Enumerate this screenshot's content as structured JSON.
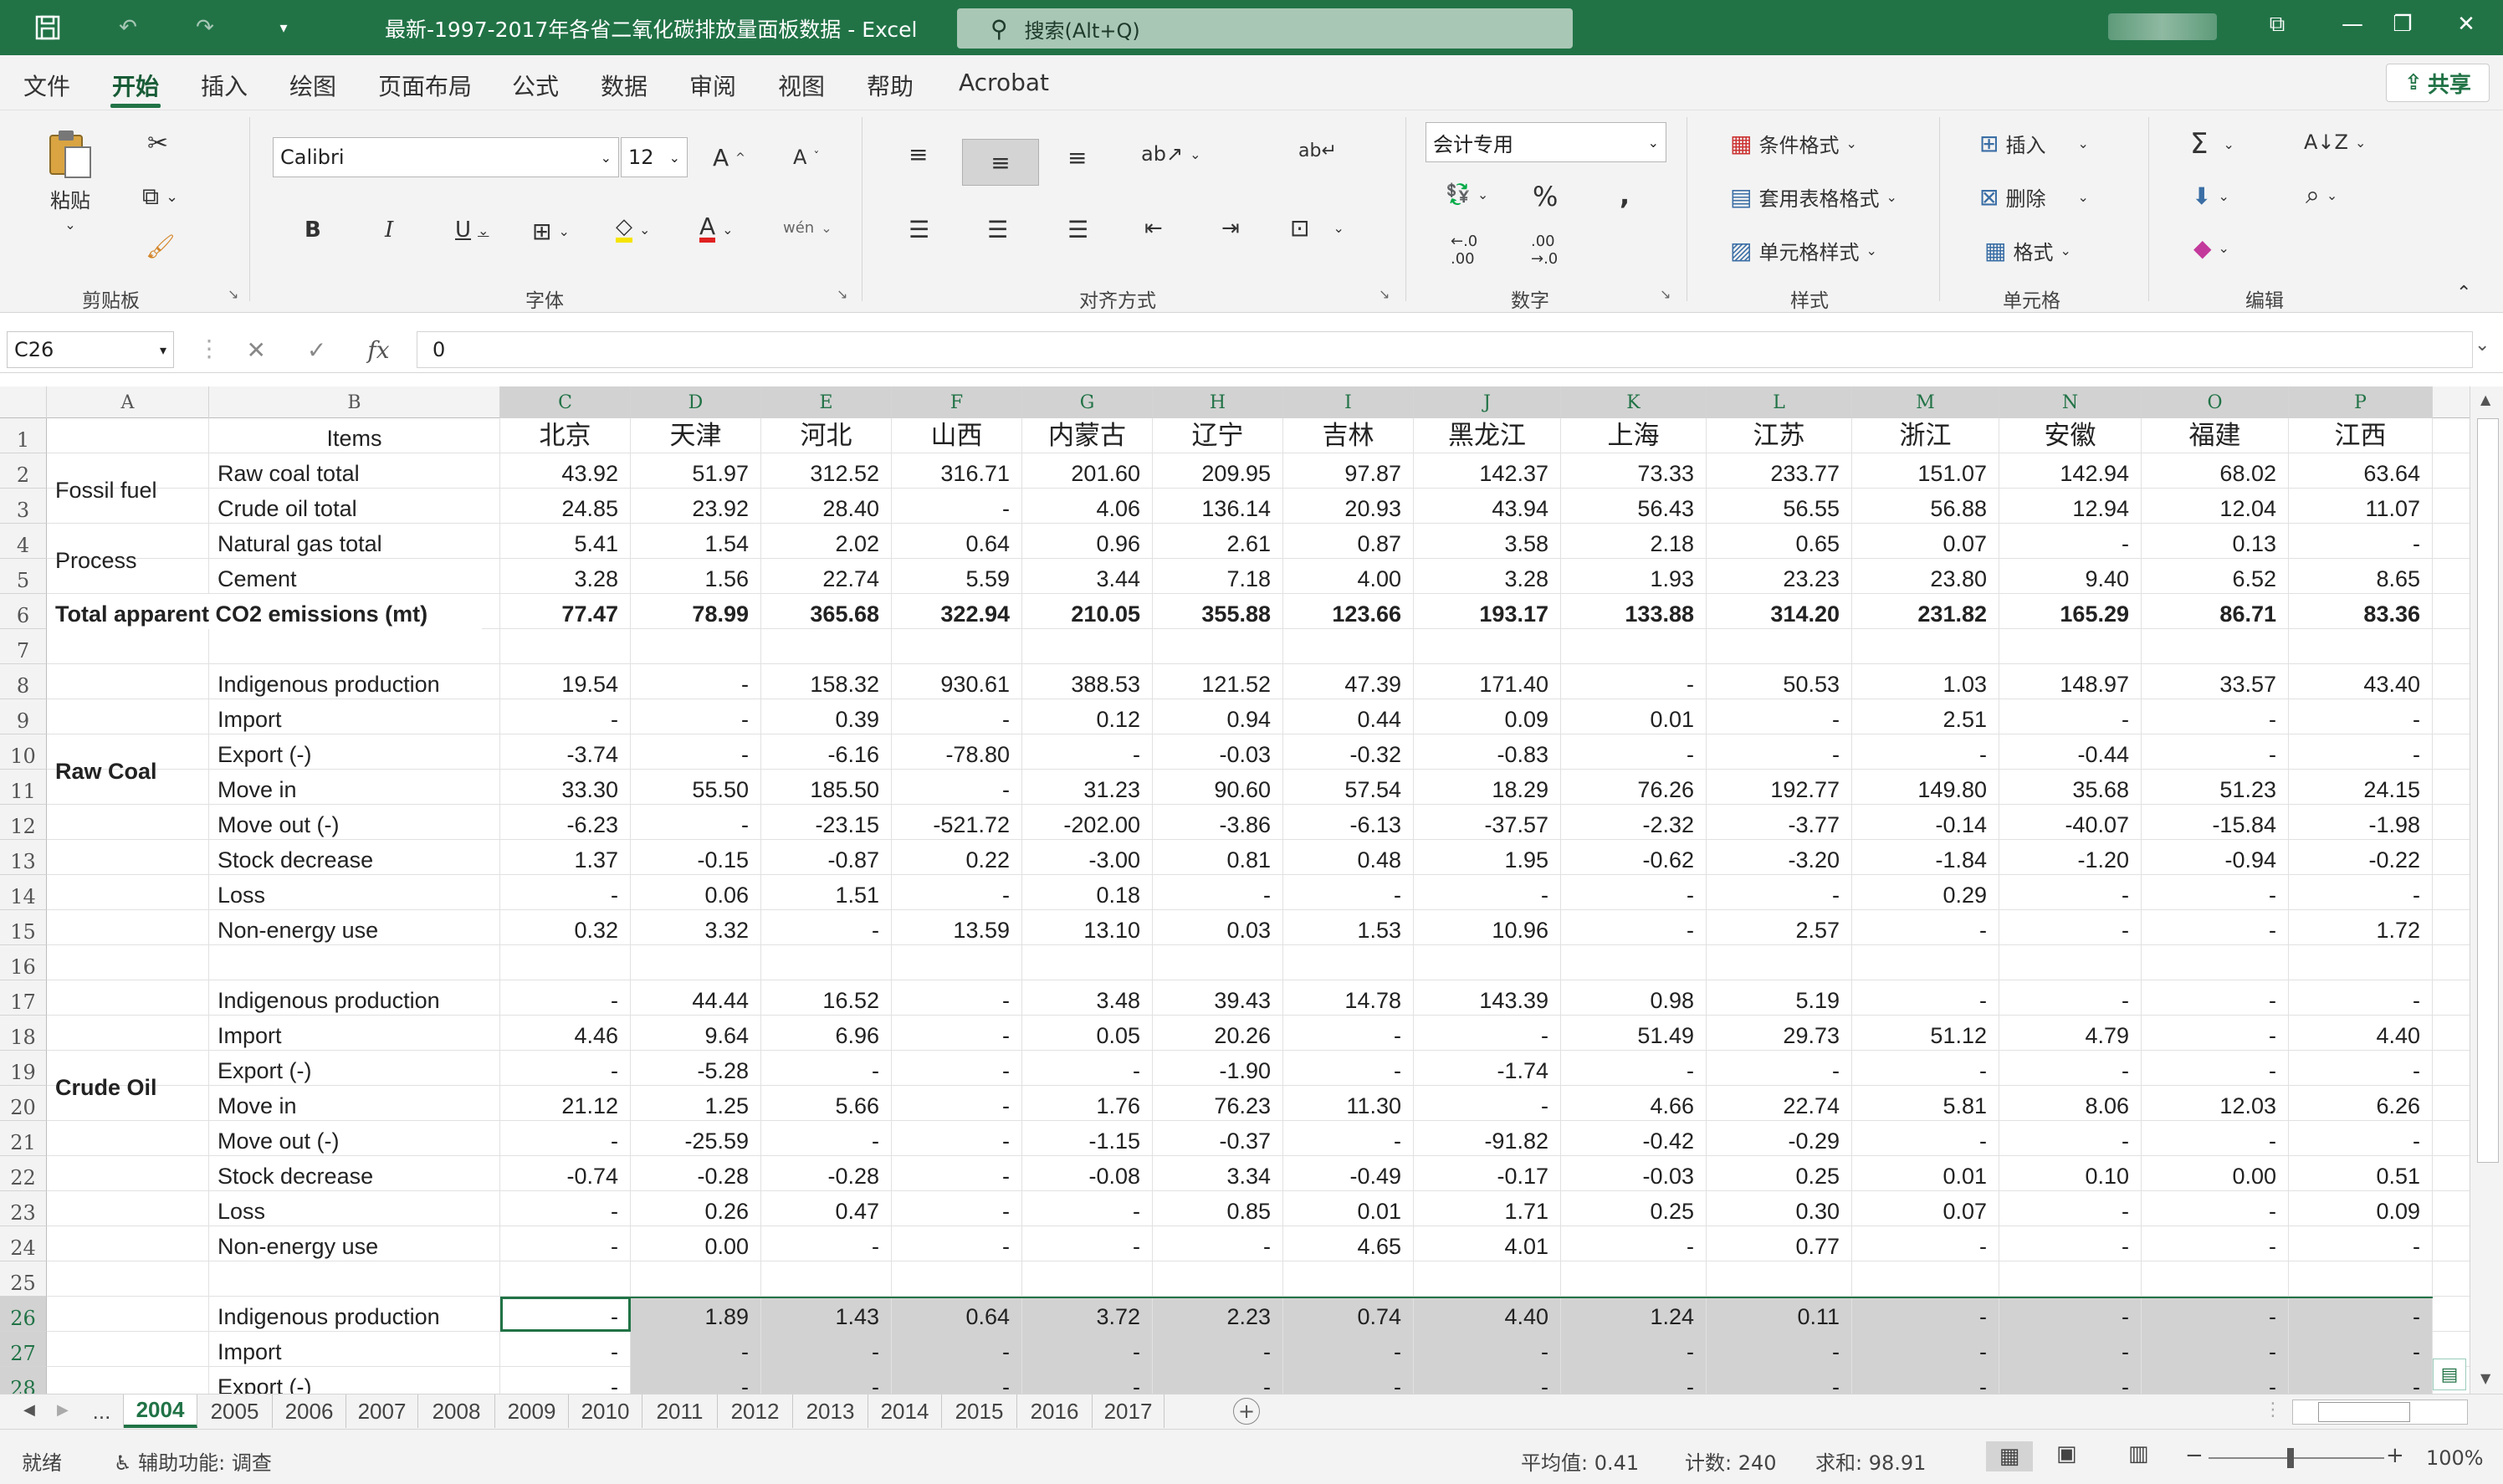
{
  "window": {
    "title": "最新-1997-2017年各省二氧化碳排放量面板数据  -  Excel",
    "search_placeholder": "搜索(Alt+Q)"
  },
  "menu": {
    "items": [
      "文件",
      "开始",
      "插入",
      "绘图",
      "页面布局",
      "公式",
      "数据",
      "审阅",
      "视图",
      "帮助",
      "Acrobat"
    ],
    "active": "开始",
    "share_label": "共享"
  },
  "ribbon": {
    "clipboard": {
      "paste_label": "粘贴",
      "group_label": "剪贴板"
    },
    "font": {
      "font_name": "Calibri",
      "font_size": "12",
      "group_label": "字体"
    },
    "alignment": {
      "group_label": "对齐方式"
    },
    "number": {
      "format": "会计专用",
      "group_label": "数字"
    },
    "styles": {
      "conditional": "条件格式",
      "table": "套用表格格式",
      "cell_styles": "单元格样式",
      "group_label": "样式"
    },
    "cells": {
      "insert": "插入",
      "delete": "删除",
      "format": "格式",
      "group_label": "单元格"
    },
    "editing": {
      "group_label": "编辑"
    }
  },
  "formula_bar": {
    "name_box": "C26",
    "formula": "0"
  },
  "columns": [
    "A",
    "B",
    "C",
    "D",
    "E",
    "F",
    "G",
    "H",
    "I",
    "J",
    "K",
    "L",
    "M",
    "N",
    "O",
    "P"
  ],
  "provinces": [
    "北京",
    "天津",
    "河北",
    "山西",
    "内蒙古",
    "辽宁",
    "吉林",
    "黑龙江",
    "上海",
    "江苏",
    "浙江",
    "安徽",
    "福建",
    "江西"
  ],
  "header_row": {
    "b": "Items"
  },
  "sections": {
    "fossil_fuel": "Fossil fuel",
    "process": "Process",
    "total": "Total apparent CO2 emissions (mt)",
    "raw_coal": "Raw Coal",
    "crude_oil": "Crude Oil"
  },
  "rows": [
    {
      "n": "1"
    },
    {
      "n": "2",
      "b": "Raw coal total",
      "v": [
        "43.92",
        "51.97",
        "312.52",
        "316.71",
        "201.60",
        "209.95",
        "97.87",
        "142.37",
        "73.33",
        "233.77",
        "151.07",
        "142.94",
        "68.02",
        "63.64"
      ]
    },
    {
      "n": "3",
      "b": "Crude oil total",
      "v": [
        "24.85",
        "23.92",
        "28.40",
        "-",
        "4.06",
        "136.14",
        "20.93",
        "43.94",
        "56.43",
        "56.55",
        "56.88",
        "12.94",
        "12.04",
        "11.07"
      ]
    },
    {
      "n": "4",
      "b": "Natural gas total",
      "v": [
        "5.41",
        "1.54",
        "2.02",
        "0.64",
        "0.96",
        "2.61",
        "0.87",
        "3.58",
        "2.18",
        "0.65",
        "0.07",
        "-",
        "0.13",
        "-"
      ]
    },
    {
      "n": "5",
      "b": "Cement",
      "v": [
        "3.28",
        "1.56",
        "22.74",
        "5.59",
        "3.44",
        "7.18",
        "4.00",
        "3.28",
        "1.93",
        "23.23",
        "23.80",
        "9.40",
        "6.52",
        "8.65"
      ]
    },
    {
      "n": "6",
      "b": "",
      "v": [
        "77.47",
        "78.99",
        "365.68",
        "322.94",
        "210.05",
        "355.88",
        "123.66",
        "193.17",
        "133.88",
        "314.20",
        "231.82",
        "165.29",
        "86.71",
        "83.36"
      ]
    },
    {
      "n": "7",
      "b": "",
      "v": []
    },
    {
      "n": "8",
      "b": "Indigenous production",
      "v": [
        "19.54",
        "-",
        "158.32",
        "930.61",
        "388.53",
        "121.52",
        "47.39",
        "171.40",
        "-",
        "50.53",
        "1.03",
        "148.97",
        "33.57",
        "43.40"
      ]
    },
    {
      "n": "9",
      "b": "Import",
      "v": [
        "-",
        "-",
        "0.39",
        "-",
        "0.12",
        "0.94",
        "0.44",
        "0.09",
        "0.01",
        "-",
        "2.51",
        "-",
        "-",
        "-"
      ]
    },
    {
      "n": "10",
      "b": "Export (-)",
      "v": [
        "-3.74",
        "-",
        "-6.16",
        "-78.80",
        "-",
        "-0.03",
        "-0.32",
        "-0.83",
        "-",
        "-",
        "-",
        "-0.44",
        "-",
        "-"
      ]
    },
    {
      "n": "11",
      "b": "Move in",
      "v": [
        "33.30",
        "55.50",
        "185.50",
        "-",
        "31.23",
        "90.60",
        "57.54",
        "18.29",
        "76.26",
        "192.77",
        "149.80",
        "35.68",
        "51.23",
        "24.15"
      ]
    },
    {
      "n": "12",
      "b": "Move out (-)",
      "v": [
        "-6.23",
        "-",
        "-23.15",
        "-521.72",
        "-202.00",
        "-3.86",
        "-6.13",
        "-37.57",
        "-2.32",
        "-3.77",
        "-0.14",
        "-40.07",
        "-15.84",
        "-1.98"
      ]
    },
    {
      "n": "13",
      "b": "Stock decrease",
      "v": [
        "1.37",
        "-0.15",
        "-0.87",
        "0.22",
        "-3.00",
        "0.81",
        "0.48",
        "1.95",
        "-0.62",
        "-3.20",
        "-1.84",
        "-1.20",
        "-0.94",
        "-0.22"
      ]
    },
    {
      "n": "14",
      "b": "Loss",
      "v": [
        "-",
        "0.06",
        "1.51",
        "-",
        "0.18",
        "-",
        "-",
        "-",
        "-",
        "-",
        "0.29",
        "-",
        "-",
        "-"
      ]
    },
    {
      "n": "15",
      "b": "Non-energy use",
      "v": [
        "0.32",
        "3.32",
        "-",
        "13.59",
        "13.10",
        "0.03",
        "1.53",
        "10.96",
        "-",
        "2.57",
        "-",
        "-",
        "-",
        "1.72"
      ]
    },
    {
      "n": "16",
      "b": "",
      "v": []
    },
    {
      "n": "17",
      "b": "Indigenous production",
      "v": [
        "-",
        "44.44",
        "16.52",
        "-",
        "3.48",
        "39.43",
        "14.78",
        "143.39",
        "0.98",
        "5.19",
        "-",
        "-",
        "-",
        "-"
      ]
    },
    {
      "n": "18",
      "b": "Import",
      "v": [
        "4.46",
        "9.64",
        "6.96",
        "-",
        "0.05",
        "20.26",
        "-",
        "-",
        "51.49",
        "29.73",
        "51.12",
        "4.79",
        "-",
        "4.40"
      ]
    },
    {
      "n": "19",
      "b": "Export (-)",
      "v": [
        "-",
        "-5.28",
        "-",
        "-",
        "-",
        "-1.90",
        "-",
        "-1.74",
        "-",
        "-",
        "-",
        "-",
        "-",
        "-"
      ]
    },
    {
      "n": "20",
      "b": "Move in",
      "v": [
        "21.12",
        "1.25",
        "5.66",
        "-",
        "1.76",
        "76.23",
        "11.30",
        "-",
        "4.66",
        "22.74",
        "5.81",
        "8.06",
        "12.03",
        "6.26"
      ]
    },
    {
      "n": "21",
      "b": "Move out (-)",
      "v": [
        "-",
        "-25.59",
        "-",
        "-",
        "-1.15",
        "-0.37",
        "-",
        "-91.82",
        "-0.42",
        "-0.29",
        "-",
        "-",
        "-",
        "-"
      ]
    },
    {
      "n": "22",
      "b": "Stock decrease",
      "v": [
        "-0.74",
        "-0.28",
        "-0.28",
        "-",
        "-0.08",
        "3.34",
        "-0.49",
        "-0.17",
        "-0.03",
        "0.25",
        "0.01",
        "0.10",
        "0.00",
        "0.51"
      ]
    },
    {
      "n": "23",
      "b": "Loss",
      "v": [
        "-",
        "0.26",
        "0.47",
        "-",
        "-",
        "0.85",
        "0.01",
        "1.71",
        "0.25",
        "0.30",
        "0.07",
        "-",
        "-",
        "0.09"
      ]
    },
    {
      "n": "24",
      "b": "Non-energy use",
      "v": [
        "-",
        "0.00",
        "-",
        "-",
        "-",
        "-",
        "4.65",
        "4.01",
        "-",
        "0.77",
        "-",
        "-",
        "-",
        "-"
      ]
    },
    {
      "n": "25",
      "b": "",
      "v": []
    },
    {
      "n": "26",
      "b": "Indigenous production",
      "v": [
        "-",
        "1.89",
        "1.43",
        "0.64",
        "3.72",
        "2.23",
        "0.74",
        "4.40",
        "1.24",
        "0.11",
        "-",
        "-",
        "-",
        "-"
      ]
    },
    {
      "n": "27",
      "b": "Import",
      "v": [
        "-",
        "-",
        "-",
        "-",
        "-",
        "-",
        "-",
        "-",
        "-",
        "-",
        "-",
        "-",
        "-",
        "-"
      ]
    },
    {
      "n": "28",
      "b": "Export (-)",
      "v": [
        "-",
        "-",
        "-",
        "-",
        "-",
        "-",
        "-",
        "-",
        "-",
        "-",
        "-",
        "-",
        "-",
        "-"
      ]
    }
  ],
  "sheet_tabs": [
    "...",
    "2004",
    "2005",
    "2006",
    "2007",
    "2008",
    "2009",
    "2010",
    "2011",
    "2012",
    "2013",
    "2014",
    "2015",
    "2016",
    "2017"
  ],
  "active_sheet": "2004",
  "status": {
    "ready": "就绪",
    "accessibility": "辅助功能: 调查",
    "average": "平均值: 0.41",
    "count": "计数: 240",
    "sum": "求和: 98.91",
    "zoom": "100%"
  }
}
